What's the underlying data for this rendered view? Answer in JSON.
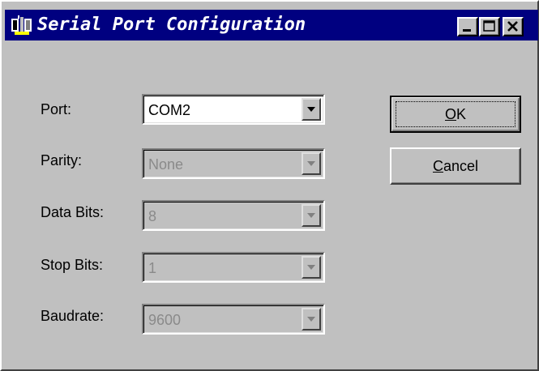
{
  "window": {
    "title": "Serial Port Configuration",
    "icon": "serial-port-icon",
    "controls": {
      "minimize": "minimize-icon",
      "maximize": "maximize-icon",
      "close": "close-icon"
    }
  },
  "fields": [
    {
      "label": "Port:",
      "value": "COM2",
      "enabled": true
    },
    {
      "label": "Parity:",
      "value": "None",
      "enabled": false
    },
    {
      "label": "Data Bits:",
      "value": "8",
      "enabled": false
    },
    {
      "label": "Stop Bits:",
      "value": "1",
      "enabled": false
    },
    {
      "label": "Baudrate:",
      "value": "9600",
      "enabled": false
    }
  ],
  "buttons": {
    "ok": {
      "mnemonic": "O",
      "rest": "K",
      "is_default": true
    },
    "cancel": {
      "mnemonic": "C",
      "rest": "ancel"
    }
  },
  "colors": {
    "titlebar": "#000080",
    "face": "#c0c0c0",
    "disabled_text": "#8a8a8a"
  }
}
